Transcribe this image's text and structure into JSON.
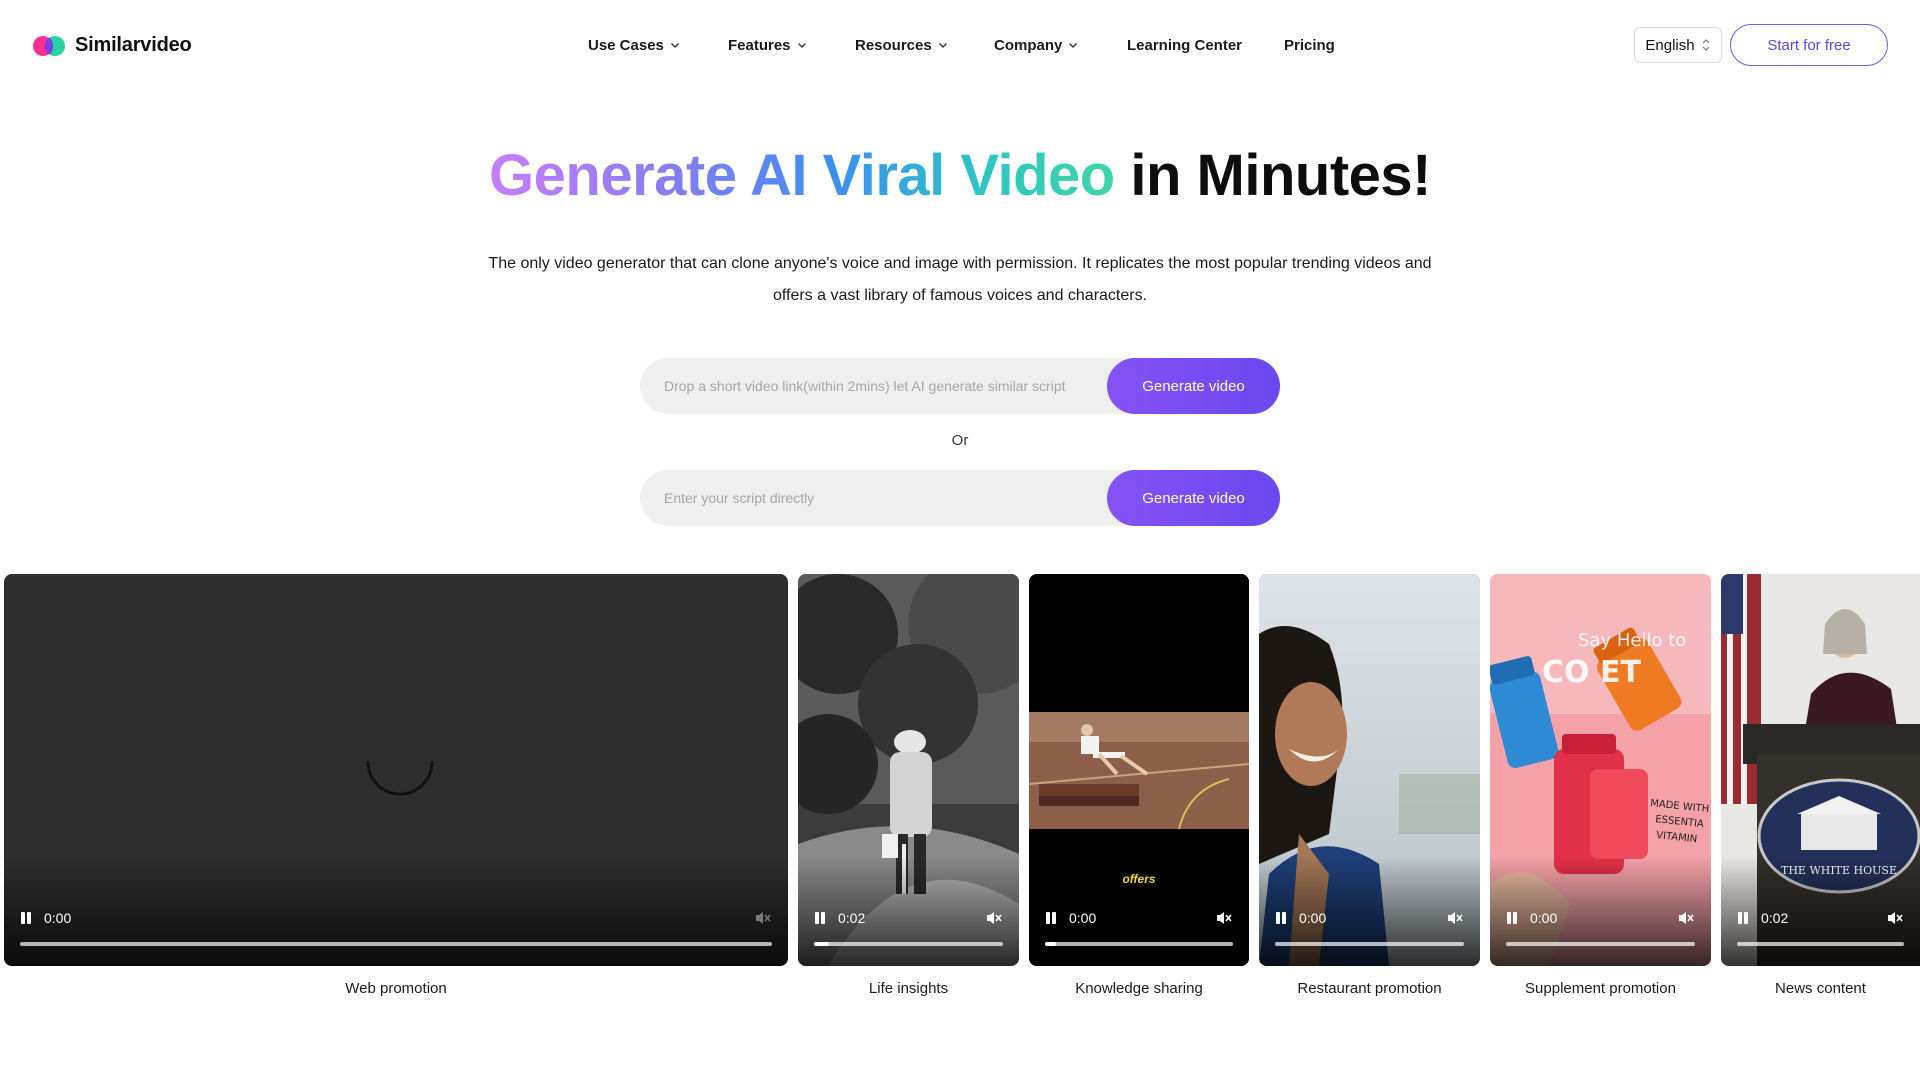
{
  "brand": {
    "name": "Similarvideo"
  },
  "nav": {
    "items": [
      {
        "label": "Use Cases",
        "dropdown": true
      },
      {
        "label": "Features",
        "dropdown": true
      },
      {
        "label": "Resources",
        "dropdown": true
      },
      {
        "label": "Company",
        "dropdown": true
      },
      {
        "label": "Learning Center",
        "dropdown": false
      },
      {
        "label": "Pricing",
        "dropdown": false
      }
    ],
    "language": "English",
    "cta": "Start for free"
  },
  "hero": {
    "title_gradient": "Generate AI Viral Video",
    "title_plain": "in Minutes!",
    "subtitle": "The only video generator that can clone anyone's voice and image with permission. It replicates the most popular trending videos and offers a vast library of famous voices and characters.",
    "link_input_placeholder": "Drop a short video link(within 2mins) let AI generate similar script",
    "link_button": "Generate video",
    "or_text": "Or",
    "script_input_placeholder": "Enter your script directly",
    "script_button": "Generate video"
  },
  "videos": [
    {
      "caption": "Web promotion",
      "time": "0:00",
      "progress": 0.0
    },
    {
      "caption": "Life insights",
      "time": "0:02",
      "progress": 0.08
    },
    {
      "caption": "Knowledge sharing",
      "time": "0:00",
      "progress": 0.06,
      "overlay_text": "offers"
    },
    {
      "caption": "Restaurant promotion",
      "time": "0:00",
      "progress": 0.0
    },
    {
      "caption": "Supplement promotion",
      "time": "0:00",
      "progress": 0.0
    },
    {
      "caption": "News content",
      "time": "0:02",
      "progress": 0.0
    }
  ],
  "colors": {
    "accent": "#6b48ef",
    "input_bg": "#efefef",
    "title_gradient": [
      "#c77dff",
      "#3c8ff0",
      "#3ed6a6"
    ]
  }
}
